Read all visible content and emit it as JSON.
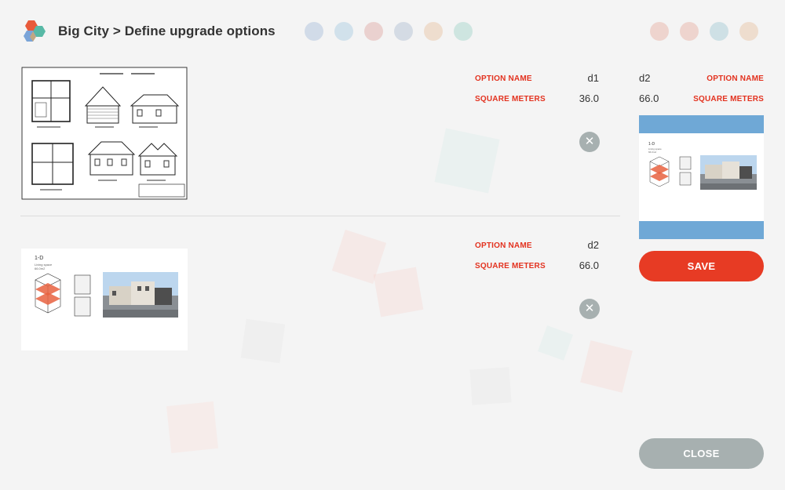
{
  "header": {
    "title": "Big City > Define upgrade options"
  },
  "field_labels": {
    "option_name": "OPTION NAME",
    "square_meters": "SQUARE METERS"
  },
  "options": [
    {
      "name": "d1",
      "square_meters": "36.0"
    },
    {
      "name": "d2",
      "square_meters": "66.0"
    }
  ],
  "editor": {
    "name": "d2",
    "square_meters": "66.0"
  },
  "buttons": {
    "save": "SAVE",
    "close": "CLOSE",
    "remove": "✕"
  },
  "drawing_text": {
    "plan_label": "1-D",
    "plan_sub1": "Living space",
    "plan_sub2": "66.0m2"
  },
  "colors": {
    "accent": "#e73b24",
    "label_red": "#e3321f",
    "neutral_button": "#a7b0b0",
    "preview_frame": "#6fa8d6",
    "background": "#f4f4f4"
  },
  "icons": {
    "app_logo": "hexagon-cluster-logo",
    "remove": "close-icon"
  }
}
